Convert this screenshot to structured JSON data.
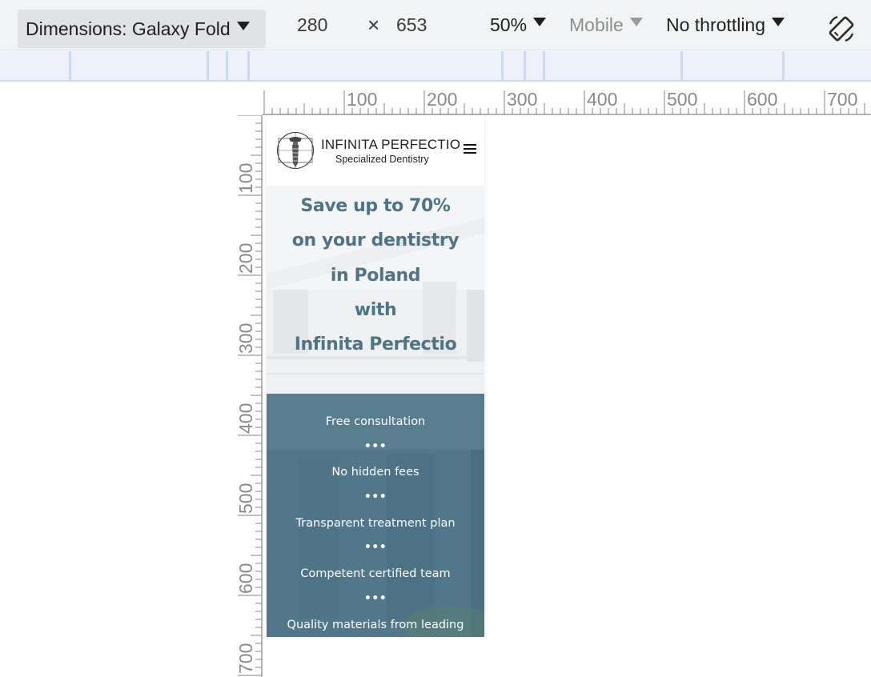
{
  "toolbar": {
    "dimensions_label": "Dimensions: Galaxy Fold",
    "width": "280",
    "times": "×",
    "height": "653",
    "zoom": "50%",
    "device_type": "Mobile",
    "throttling": "No throttling",
    "icons": {
      "rotate": "rotate-icon",
      "dropdown": "caret-down-icon"
    }
  },
  "ruler": {
    "top_labels": [
      "100",
      "200",
      "300",
      "400",
      "500",
      "600",
      "700"
    ],
    "left_labels": [
      "100",
      "200",
      "300",
      "400",
      "500",
      "600",
      "700"
    ]
  },
  "site": {
    "brand_name": "INFINITA PERFECTIO",
    "tagline": "Specialized Dentistry",
    "hero_lines": [
      "Save up to 70%",
      "on your dentistry",
      "in Poland",
      "with",
      "Infinita Perfectio"
    ],
    "separator": "•••",
    "features": [
      "Free consultation",
      "No hidden fees",
      "Transparent treatment plan",
      "Competent certified team",
      "Quality materials from leading"
    ],
    "colors": {
      "hero_text": "#4d7587",
      "features_bg": "#557b8d",
      "features_text": "#ffffff"
    }
  }
}
